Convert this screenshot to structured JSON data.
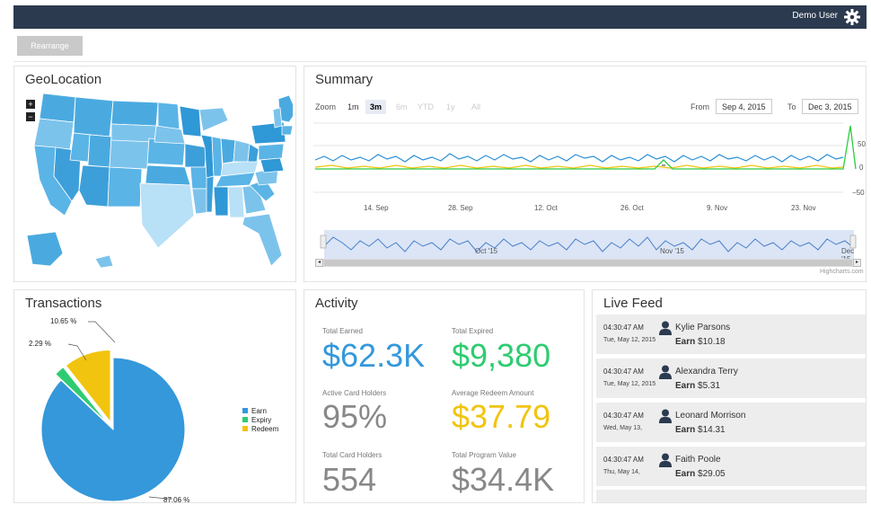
{
  "header": {
    "user_name": "Demo User"
  },
  "toolbar": {
    "rearrange_label": "Rearrange"
  },
  "geolocation": {
    "title": "GeoLocation",
    "zoom_in": "+",
    "zoom_out": "−"
  },
  "summary": {
    "title": "Summary",
    "zoom_label": "Zoom",
    "zoom_options": [
      "1m",
      "3m",
      "6m",
      "YTD",
      "1y",
      "All"
    ],
    "zoom_selected": "3m",
    "from_label": "From",
    "from_value": "Sep 4, 2015",
    "to_label": "To",
    "to_value": "Dec 3, 2015",
    "x_ticks": [
      "14. Sep",
      "28. Sep",
      "12. Oct",
      "26. Oct",
      "9. Nov",
      "23. Nov"
    ],
    "y_ticks": [
      "50",
      "0",
      "−50"
    ],
    "navigator_ticks": [
      "Oct '15",
      "Nov '15",
      "Dec '15"
    ],
    "credit": "Highcharts.com",
    "colors": {
      "earn": "#2b8fd6",
      "expiry": "#2ecc40",
      "redeem": "#f1c40f"
    }
  },
  "transactions": {
    "title": "Transactions",
    "slice_labels": [
      "10.65 %",
      "2.29 %",
      "87.06 %"
    ],
    "legend": [
      "Earn",
      "Expiry",
      "Redeem"
    ]
  },
  "chart_data": {
    "type": "pie",
    "categories": [
      "Earn",
      "Expiry",
      "Redeem"
    ],
    "values": [
      87.06,
      2.29,
      10.65
    ],
    "colors": [
      "#3498db",
      "#2ecc71",
      "#f1c40f"
    ],
    "legend_position": "right"
  },
  "activity": {
    "title": "Activity",
    "total_earned_label": "Total Earned",
    "total_earned": "$62.3K",
    "total_expired_label": "Total Expired",
    "total_expired": "$9,380",
    "active_holders_label": "Active Card Holders",
    "active_holders": "95%",
    "avg_redeem_label": "Average Redeem Amount",
    "avg_redeem": "$37.79",
    "total_holders_label": "Total Card Holders",
    "total_holders": "554",
    "program_value_label": "Total Program Value",
    "program_value": "$34.4K"
  },
  "live_feed": {
    "title": "Live Feed",
    "items": [
      {
        "time": "04:30:47 AM",
        "date": "Tue, May 12, 2015",
        "name": "Kylie Parsons",
        "earn_label": "Earn",
        "amount": "$10.18"
      },
      {
        "time": "04:30:47 AM",
        "date": "Tue, May 12, 2015",
        "name": "Alexandra Terry",
        "earn_label": "Earn",
        "amount": "$5.31"
      },
      {
        "time": "04:30:47 AM",
        "date": "Wed, May 13,",
        "name": "Leonard Morrison",
        "earn_label": "Earn",
        "amount": "$14.31"
      },
      {
        "time": "04:30:47 AM",
        "date": "Thu, May 14,",
        "name": "Faith Poole",
        "earn_label": "Earn",
        "amount": "$29.05"
      }
    ]
  }
}
